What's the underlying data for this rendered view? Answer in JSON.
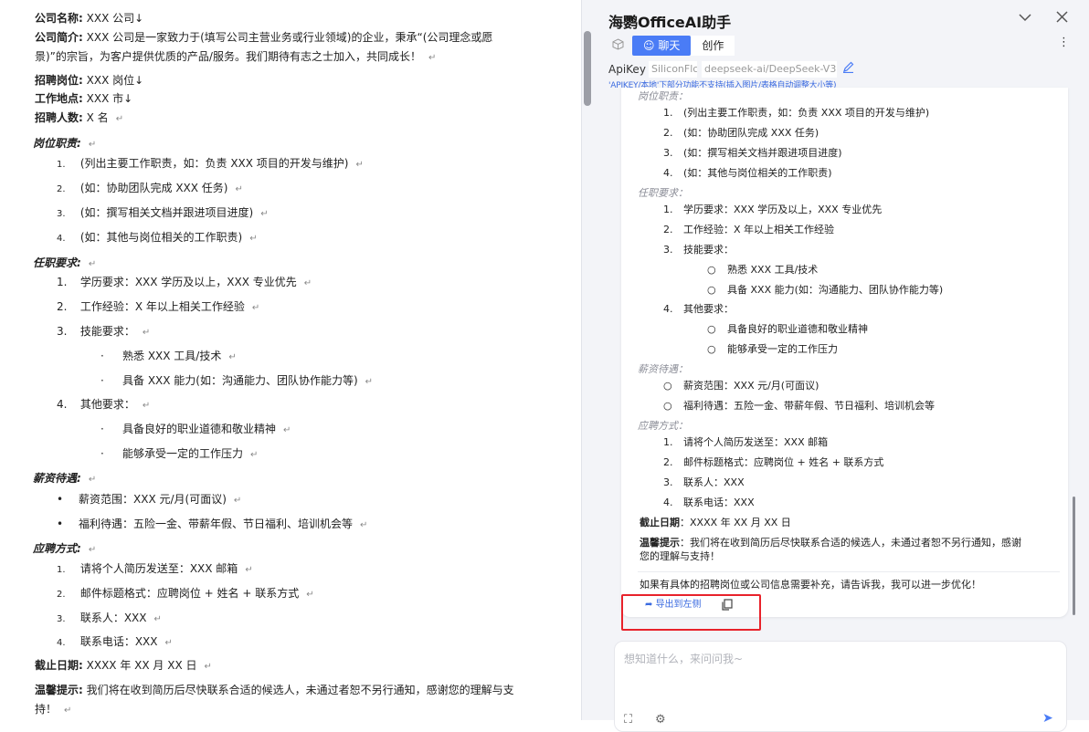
{
  "document": {
    "company_name_label": "公司名称:",
    "company_name_value": "XXX 公司↓",
    "company_intro_label": "公司简介:",
    "company_intro_line1": "XXX 公司是一家致力于(填写公司主营业务或行业领域)的企业，秉承“(公司理念或愿",
    "company_intro_line2": "景)”的宗旨，为客户提供优质的产品/服务。我们期待有志之士加入，共同成长！",
    "position_label": "招聘岗位:",
    "position_value": "XXX 岗位↓",
    "location_label": "工作地点:",
    "location_value": "XXX 市↓",
    "headcount_label": "招聘人数:",
    "headcount_value": "X 名",
    "duties_heading": "岗位职责:",
    "duties": [
      {
        "n": "1.",
        "t": "(列出主要工作职责，如：负责 XXX 项目的开发与维护)"
      },
      {
        "n": "2.",
        "t": "(如：协助团队完成 XXX 任务)"
      },
      {
        "n": "3.",
        "t": "(如：撰写相关文档并跟进项目进度)"
      },
      {
        "n": "4.",
        "t": "(如：其他与岗位相关的工作职责)"
      }
    ],
    "req_heading": "任职要求:",
    "req": [
      {
        "n": "1.",
        "t": "学历要求：XXX 学历及以上，XXX 专业优先"
      },
      {
        "n": "2.",
        "t": "工作经验：X 年以上相关工作经验"
      },
      {
        "n": "3.",
        "t": "技能要求："
      }
    ],
    "skills": [
      "熟悉 XXX 工具/技术",
      "具备 XXX 能力(如：沟通能力、团队协作能力等)"
    ],
    "other_item": {
      "n": "4.",
      "t": "其他要求："
    },
    "other": [
      "具备良好的职业道德和敬业精神",
      "能够承受一定的工作压力"
    ],
    "salary_heading": "薪资待遇:",
    "salary": [
      "薪资范围：XXX 元/月(可面议)",
      "福利待遇：五险一金、带薪年假、节日福利、培训机会等"
    ],
    "apply_heading": "应聘方式:",
    "apply": [
      {
        "n": "1.",
        "t": "请将个人简历发送至：XXX 邮箱"
      },
      {
        "n": "2.",
        "t": "邮件标题格式：应聘岗位 + 姓名 + 联系方式"
      },
      {
        "n": "3.",
        "t": "联系人：XXX"
      },
      {
        "n": "4.",
        "t": "联系电话：XXX"
      }
    ],
    "deadline_label": "截止日期:",
    "deadline_value": "XXXX 年 XX 月 XX 日",
    "tip_label": "温馨提示:",
    "tip_line1": "我们将在收到简历后尽快联系合适的候选人，未通过者恕不另行通知，感谢您的理解与支",
    "tip_line2": "持！",
    "para_mark": "↵",
    "bullet_small": "·",
    "bullet_dot": "•"
  },
  "panel": {
    "title": "海鹦OfficeAI助手",
    "tab_chat": "聊天",
    "tab_create": "创作",
    "apikey_label": "ApiKey",
    "apikey_provider": "SiliconFlc",
    "apikey_model": "deepseek-ai/DeepSeek-V3",
    "apikey_note": "'APIKEY/本地'下部分功能不支持(插入图片/表格自动调整大小等)",
    "chat": {
      "duties_heading": "岗位职责：",
      "duties": [
        {
          "n": "1.",
          "t": "(列出主要工作职责，如：负责 XXX 项目的开发与维护)"
        },
        {
          "n": "2.",
          "t": "(如：协助团队完成 XXX 任务)"
        },
        {
          "n": "3.",
          "t": "(如：撰写相关文档并跟进项目进度)"
        },
        {
          "n": "4.",
          "t": "(如：其他与岗位相关的工作职责)"
        }
      ],
      "req_heading": "任职要求：",
      "req": [
        {
          "n": "1.",
          "t": "学历要求：XXX 学历及以上，XXX 专业优先"
        },
        {
          "n": "2.",
          "t": "工作经验：X 年以上相关工作经验"
        },
        {
          "n": "3.",
          "t": "技能要求："
        }
      ],
      "skills": [
        "熟悉 XXX 工具/技术",
        "具备 XXX 能力(如：沟通能力、团队协作能力等)"
      ],
      "other_item": {
        "n": "4.",
        "t": "其他要求："
      },
      "other": [
        "具备良好的职业道德和敬业精神",
        "能够承受一定的工作压力"
      ],
      "salary_heading": "薪资待遇：",
      "salary": [
        "薪资范围：XXX 元/月(可面议)",
        "福利待遇：五险一金、带薪年假、节日福利、培训机会等"
      ],
      "apply_heading": "应聘方式：",
      "apply": [
        {
          "n": "1.",
          "t": "请将个人简历发送至：XXX 邮箱"
        },
        {
          "n": "2.",
          "t": "邮件标题格式：应聘岗位 + 姓名 + 联系方式"
        },
        {
          "n": "3.",
          "t": "联系人：XXX"
        },
        {
          "n": "4.",
          "t": "联系电话：XXX"
        }
      ],
      "deadline_label": "截止日期",
      "deadline_value": "：XXXX 年 XX 月 XX 日",
      "tip_label": "温馨提示",
      "tip_line1": "：我们将在收到简历后尽快联系合适的候选人，未通过者恕不另行通知，感谢",
      "tip_line2": "您的理解与支持！",
      "followup": "如果有具体的招聘岗位或公司信息需要补充，请告诉我，我可以进一步优化！",
      "circle_bullet": "○"
    },
    "export_label": "导出到左侧",
    "input_placeholder": "想知道什么，来问问我~"
  },
  "colors": {
    "accent": "#4a7cf6",
    "highlight": "#e8222b",
    "panel_bg": "#f3f4f8",
    "link": "#3a6ae0"
  }
}
